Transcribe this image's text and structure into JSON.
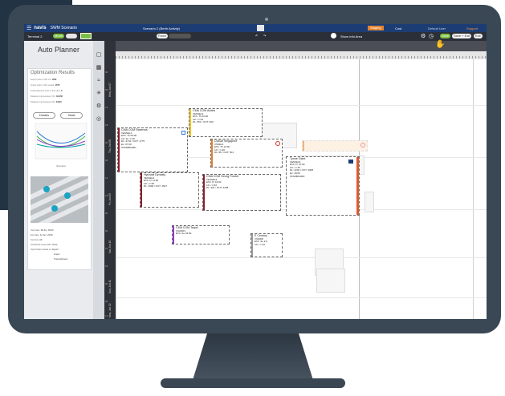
{
  "app": {
    "logo": "navis",
    "product": "SWM Scenario",
    "menu_icon": "hamburger-icon",
    "scenario": "Scenario 2 (Berth Activity)",
    "terminal": "Terminal 2",
    "mode_badge": "Mode",
    "highlight_badge": "Staging",
    "user": "Default User",
    "timezone": "Cost",
    "help_link": "Support",
    "show_info": "Show Info Area",
    "save_label": "Save",
    "save_exit_label": "Save + Exit",
    "exit_label": "Exit",
    "fixed_label": "Fixed",
    "colors": {
      "appbar": "#1c3c74",
      "toolbar": "#2b2f38",
      "accent_orange": "#e0822c",
      "accent_green": "#7bbf44"
    }
  },
  "left": {
    "title": "Auto Planner",
    "optimization": {
      "title": "Optimization Results",
      "rows": [
        {
          "label": "Export units in this vsl:",
          "value": "1500"
        },
        {
          "label": "Import units in this vessel:",
          "value": "1575"
        },
        {
          "label": "Transshipment units in this yard:",
          "value": "0"
        },
        {
          "label": "Distance improvement (%):",
          "value": "32.350"
        },
        {
          "label": "Distance improvement (%):",
          "value": "8.840"
        }
      ],
      "details_label": "Details",
      "table_label": "Table",
      "chart_xlabel": "Scenario",
      "meta": [
        {
          "label": "Start date:",
          "value": "08 Jun, 00:00"
        },
        {
          "label": "End date:",
          "value": "12 Jun, 23:59"
        },
        {
          "label": "Services:",
          "value": "All"
        },
        {
          "label": "Scheduled vessel filter:",
          "value": "None"
        },
        {
          "label": "Optimization based on:",
          "value": "Export"
        },
        {
          "label": "",
          "value": "Import"
        },
        {
          "label": "",
          "value": "Transshipment"
        }
      ]
    }
  },
  "rows": {
    "day_labels": [
      "Wed, Jun 07",
      "Thu, Jun 08",
      "Fri, Jun 09",
      "Sat, Jun 10",
      "Sun, Jun 11",
      "Mon, Jun 12"
    ],
    "hour_labels": [
      "00",
      "06",
      "12",
      "18",
      "00",
      "06",
      "12",
      "18",
      "00",
      "06",
      "12",
      "18",
      "00",
      "06",
      "12"
    ]
  },
  "vessels": [
    {
      "name": "CMA CGM Ravenna",
      "lines": [
        "VESSEL1",
        "ETA: Th 00:00",
        "LD: 11 / 1.45",
        "DL: 2744 / OUT: 1775",
        "Ex: 07:00",
        "STARBOARD"
      ],
      "color": "#8b1e2a"
    },
    {
      "name": "CMA CGM Andes",
      "lines": [
        "VESSEL2",
        "ETA: Th 00:00",
        "LD: / 1.63",
        "DL: 551 / OUT: 300"
      ],
      "color": "#f0c419"
    },
    {
      "name": "DUBAI Singapore",
      "lines": [
        "VSSEL3",
        "ETA: Th 12:00",
        "LD: / 1.90",
        "DL: 85 / OUT: 501"
      ],
      "color": "#e0822c"
    },
    {
      "name": "Hyundai Dynasty",
      "lines": [
        "VESSEL4",
        "ETA: Fr 11:00",
        "LD: / 1.55",
        "DL: 1900 / OUT: 1627"
      ],
      "color": "#8b1e2a"
    },
    {
      "name": "CMA CGM Georg Forster",
      "lines": [
        "VESSEL5",
        "ETA: Fr 10:00",
        "LD: / 1.52",
        "DL: 201 / OUT: 2208"
      ],
      "color": "#8b1e2a"
    },
    {
      "name": "Tynne Giant",
      "lines": [
        "VESSEL6",
        "ETA: Fr 07:00",
        "LD: / 1.45",
        "DL: 2204 / OUT: 3308",
        "Ex: 18:00",
        "STARBOARD"
      ],
      "color": "#e2582a"
    },
    {
      "name": "CMA CGM Taipei",
      "lines": [
        "CGM001",
        "ETA: Su 03:00"
      ],
      "color": "#8e3acb"
    },
    {
      "name": "E Century",
      "lines": [
        "VSS005",
        "ETA: Su 2:0",
        "LD: / 1.10"
      ],
      "color": "#999999"
    }
  ]
}
